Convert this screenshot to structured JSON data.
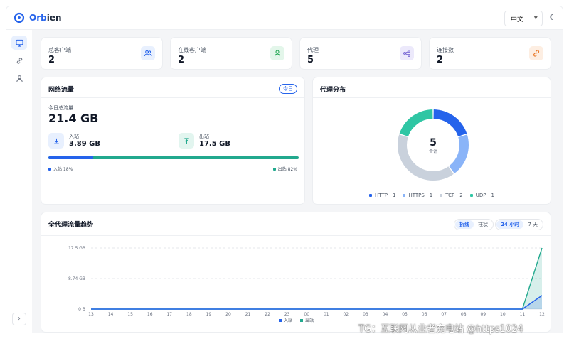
{
  "app": {
    "brand_prefix": "Orb",
    "brand_suffix": "ien"
  },
  "header": {
    "language": "中文"
  },
  "stats": [
    {
      "label": "总客户端",
      "value": "2"
    },
    {
      "label": "在线客户端",
      "value": "2"
    },
    {
      "label": "代理",
      "value": "5"
    },
    {
      "label": "连接数",
      "value": "2"
    }
  ],
  "traffic": {
    "title": "网络流量",
    "badge": "今日",
    "total_label": "今日总流量",
    "total_value": "21.4 GB",
    "in_label": "入站",
    "in_value": "3.89 GB",
    "out_label": "出站",
    "out_value": "17.5 GB",
    "in_percent": 18,
    "in_legend": "入站 18%",
    "out_legend": "出站 82%"
  },
  "proxy": {
    "title": "代理分布",
    "total": "5",
    "total_label": "合计",
    "items": [
      {
        "name": "HTTP",
        "count": "1",
        "value": 1,
        "color": "#2563eb"
      },
      {
        "name": "HTTPS",
        "count": "1",
        "value": 1,
        "color": "#8ab4f8"
      },
      {
        "name": "TCP",
        "count": "2",
        "value": 2,
        "color": "#c9d1dc"
      },
      {
        "name": "UDP",
        "count": "1",
        "value": 1,
        "color": "#2fc6a4"
      }
    ]
  },
  "trend": {
    "title": "全代理流量趋势",
    "mode_options": [
      "折线",
      "柱状"
    ],
    "range_options": [
      "24 小时",
      "7 天"
    ]
  },
  "colors": {
    "accent": "#2563eb",
    "teal": "#22a98e"
  },
  "chart_data": {
    "type": "area",
    "x": [
      "13",
      "14",
      "15",
      "16",
      "17",
      "18",
      "19",
      "20",
      "21",
      "22",
      "23",
      "00",
      "01",
      "02",
      "03",
      "04",
      "05",
      "06",
      "07",
      "08",
      "09",
      "10",
      "11",
      "12"
    ],
    "y_ticks": [
      "17.5 GB",
      "8.74 GB",
      "0 B"
    ],
    "ylim": [
      0,
      17.5
    ],
    "series": [
      {
        "name": "入站",
        "color": "#2563eb",
        "values": [
          0,
          0,
          0,
          0,
          0,
          0,
          0,
          0,
          0,
          0,
          0,
          0,
          0,
          0,
          0,
          0,
          0,
          0,
          0,
          0,
          0,
          0,
          0,
          3.89
        ]
      },
      {
        "name": "出站",
        "color": "#22a98e",
        "values": [
          0,
          0,
          0,
          0,
          0,
          0,
          0,
          0,
          0,
          0,
          0,
          0,
          0,
          0,
          0,
          0,
          0,
          0,
          0,
          0,
          0,
          0,
          0,
          17.5
        ]
      }
    ],
    "legend_position": "bottom"
  },
  "watermark": "TG：互联网从业者充电站 @https1024"
}
